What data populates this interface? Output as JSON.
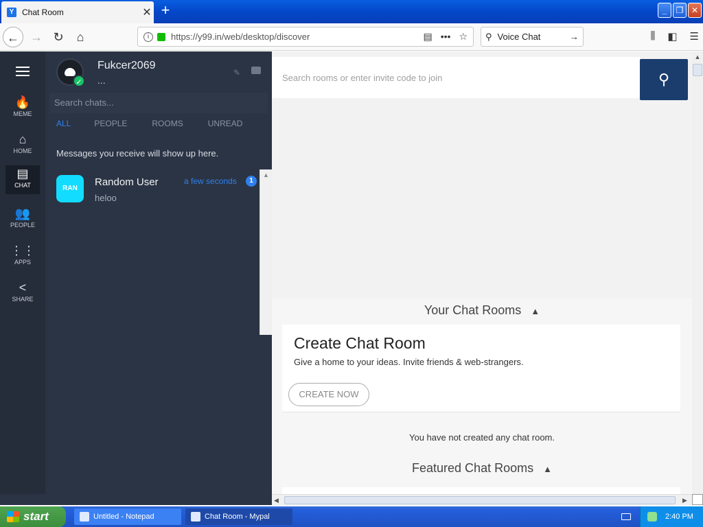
{
  "browser": {
    "tab_title": "Chat Room",
    "tab_icon_glyph": "Y",
    "url": "https://y99.in/web/desktop/discover",
    "search_value": "Voice Chat"
  },
  "rail": {
    "items": [
      {
        "label": "MEME",
        "glyph": "🔥"
      },
      {
        "label": "HOME",
        "glyph": "⌂"
      },
      {
        "label": "CHAT",
        "glyph": "▤"
      },
      {
        "label": "PEOPLE",
        "glyph": "👥"
      },
      {
        "label": "APPS",
        "glyph": "⋮⋮"
      },
      {
        "label": "SHARE",
        "glyph": "<"
      }
    ]
  },
  "profile": {
    "username": "Fukcer2069",
    "status": "..."
  },
  "chats": {
    "search_placeholder": "Search chats...",
    "filters": [
      "ALL",
      "PEOPLE",
      "ROOMS",
      "UNREAD"
    ],
    "hint": "Messages you receive will show up here.",
    "items": [
      {
        "avatar_text": "RAN",
        "name": "Random User",
        "preview": "heloo",
        "time": "a few seconds",
        "unread": "1"
      }
    ]
  },
  "main": {
    "search_placeholder": "Search rooms or enter invite code to join",
    "your_rooms_title": "Your Chat Rooms",
    "create_title": "Create Chat Room",
    "create_sub": "Give a home to your ideas. Invite friends & web-strangers.",
    "create_button": "CREATE NOW",
    "no_rooms": "You have not created any chat room.",
    "featured_title": "Featured Chat Rooms"
  },
  "taskbar": {
    "start": "start",
    "tasks": [
      "Untitled - Notepad",
      "Chat Room - Mypal"
    ],
    "clock": "2:40 PM"
  },
  "colors": {
    "rail_bg": "#252d3a",
    "panel_bg": "#2b3444",
    "accent": "#2f80ed",
    "search_button": "#1b3d6e"
  }
}
